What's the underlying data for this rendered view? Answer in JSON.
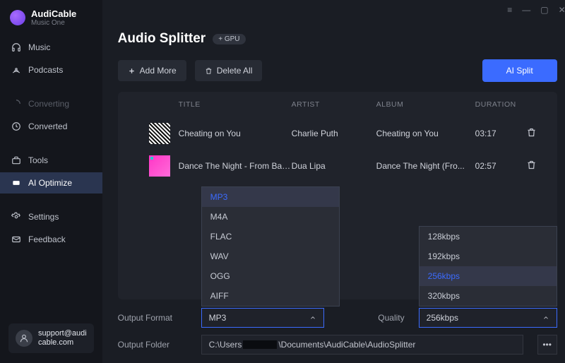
{
  "brand": {
    "name": "AudiCable",
    "subtitle": "Music One"
  },
  "nav": {
    "music": "Music",
    "podcasts": "Podcasts",
    "converting": "Converting",
    "converted": "Converted",
    "tools": "Tools",
    "ai_optimize": "AI Optimize",
    "settings": "Settings",
    "feedback": "Feedback"
  },
  "support": {
    "line1": "support@audi",
    "line2": "cable.com"
  },
  "page": {
    "title": "Audio Splitter",
    "gpu_badge": "+ GPU"
  },
  "actions": {
    "add_more": "Add More",
    "delete_all": "Delete All",
    "ai_split": "AI Split"
  },
  "columns": {
    "title": "TITLE",
    "artist": "ARTIST",
    "album": "ALBUM",
    "duration": "DURATION"
  },
  "tracks": [
    {
      "title": "Cheating on You",
      "artist": "Charlie Puth",
      "album": "Cheating on You",
      "duration": "03:17"
    },
    {
      "title": "Dance The Night - From Barb...",
      "artist": "Dua Lipa",
      "album": "Dance The Night (Fro...",
      "duration": "02:57"
    }
  ],
  "footer": {
    "output_format_label": "Output Format",
    "output_format_value": "MP3",
    "format_options": [
      "MP3",
      "M4A",
      "FLAC",
      "WAV",
      "OGG",
      "AIFF"
    ],
    "quality_label": "Quality",
    "quality_value": "256kbps",
    "quality_options": [
      "128kbps",
      "192kbps",
      "256kbps",
      "320kbps"
    ],
    "output_folder_label": "Output Folder",
    "output_folder_prefix": "C:\\Users",
    "output_folder_suffix": "\\Documents\\AudiCable\\AudioSplitter"
  }
}
